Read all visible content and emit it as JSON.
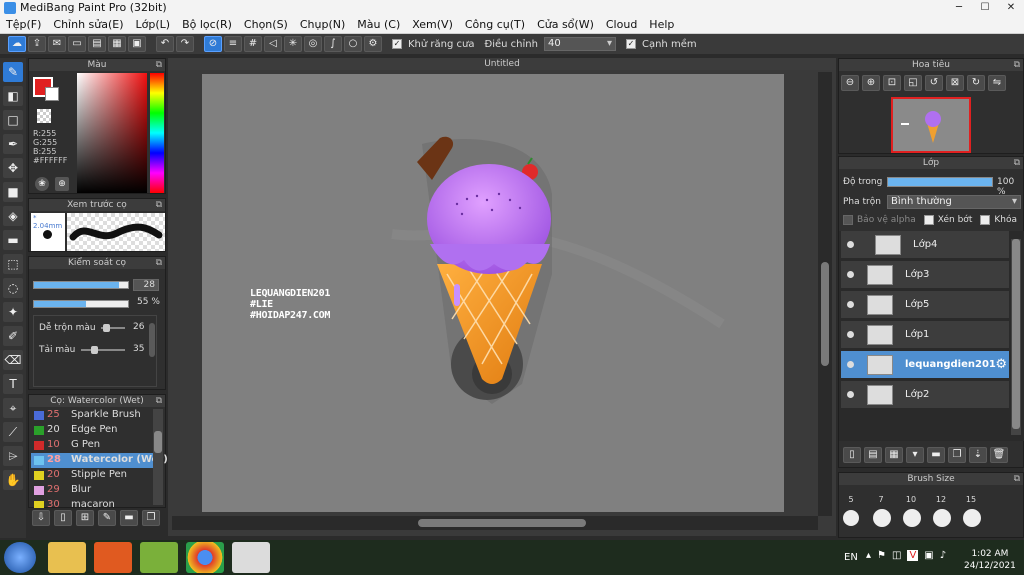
{
  "window": {
    "title": "MediBang Paint Pro (32bit)",
    "minimize": "─",
    "maximize": "☐",
    "close": "✕"
  },
  "menu": [
    "Tệp(F)",
    "Chỉnh sửa(E)",
    "Lớp(L)",
    "Bộ lọc(R)",
    "Chọn(S)",
    "Chụp(N)",
    "Màu (C)",
    "Xem(V)",
    "Công cụ(T)",
    "Cửa sổ(W)",
    "Cloud",
    "Help"
  ],
  "toolbar": {
    "antialias_label": "Khử răng cưa",
    "adjust_label": "Điều chỉnh",
    "adjust_value": "40",
    "sharp_label": "Cạnh mềm"
  },
  "color_panel": {
    "title": "Màu",
    "r": "R:255",
    "g": "G:255",
    "b": "B:255",
    "hex": "#FFFFFF"
  },
  "brush_preview": {
    "title": "Xem trước cọ",
    "size": "* 2.04mm"
  },
  "brush_control": {
    "title": "Kiểm soát cọ",
    "size_value": "28",
    "opacity_value": "55 %",
    "blend_label": "Dễ trộn màu",
    "blend_value": "26",
    "color_amount_label": "Tải màu",
    "color_amount_value": "35",
    "size_fill": 0.9,
    "opacity_fill": 0.55
  },
  "brush_list": {
    "title": "Cọ: Watercolor (Wet)",
    "items": [
      {
        "num": "25",
        "name": "Sparkle Brush",
        "color": "#4a6bd8"
      },
      {
        "num": "20",
        "name": "Edge Pen",
        "color": "#2aa02a"
      },
      {
        "num": "10",
        "name": "G Pen",
        "color": "#d02a2a"
      },
      {
        "num": "28",
        "name": "Watercolor (Wet)",
        "color": "#6dc3f0"
      },
      {
        "num": "20",
        "name": "Stipple Pen",
        "color": "#e0d020"
      },
      {
        "num": "29",
        "name": "Blur",
        "color": "#e0a0e0"
      },
      {
        "num": "30",
        "name": "macaron",
        "color": "#e0d020"
      }
    ]
  },
  "canvas": {
    "title": "Untitled",
    "watermark_line1": "LEQUANGDIEN201",
    "watermark_line2": "#LIE",
    "watermark_line3": "#HOIDAP247.COM"
  },
  "navigator": {
    "title": "Hoa tiêu"
  },
  "layers": {
    "title": "Lớp",
    "opacity_label": "Độ trong",
    "opacity_value": "100 %",
    "opacity_fill": 1.0,
    "blend_label": "Pha trộn",
    "blend_value": "Bình thường",
    "protect_alpha": "Bảo vệ alpha",
    "clipping": "Xén bớt",
    "lock": "Khóa",
    "items": [
      {
        "name": "Lớp4",
        "selected": false
      },
      {
        "name": "Lớp3",
        "selected": false
      },
      {
        "name": "Lớp5",
        "selected": false
      },
      {
        "name": "Lớp1",
        "selected": false
      },
      {
        "name": "lequangdien201",
        "selected": true
      },
      {
        "name": "Lớp2",
        "selected": false
      }
    ]
  },
  "brush_size": {
    "title": "Brush Size",
    "sizes": [
      "5",
      "7",
      "10",
      "12",
      "15"
    ]
  },
  "taskbar": {
    "lang": "EN",
    "time": "1:02 AM",
    "date": "24/12/2021"
  }
}
